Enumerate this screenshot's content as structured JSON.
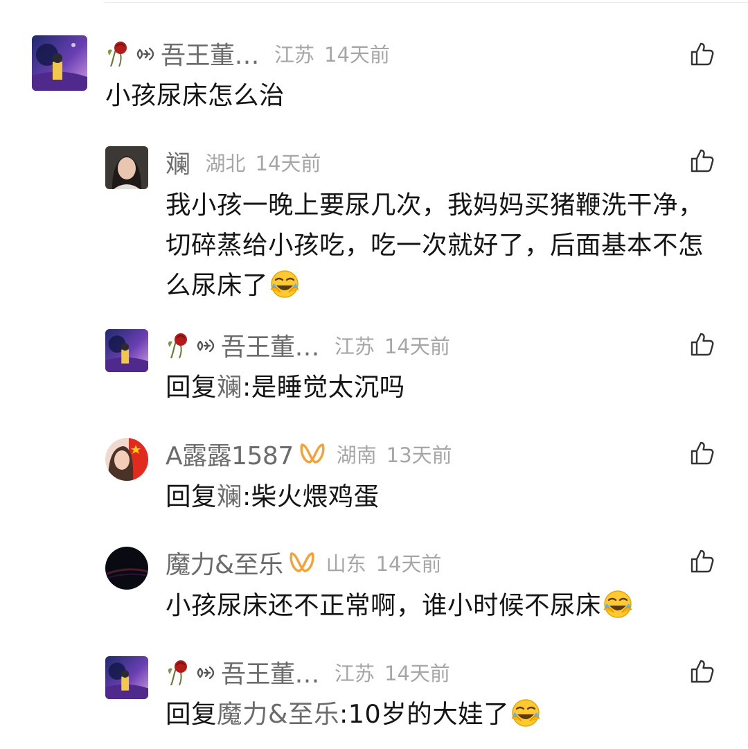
{
  "comments": [
    {
      "username": "吾王董…",
      "location": "江苏",
      "time": "14天前",
      "text": "小孩尿床怎么治"
    },
    {
      "username": "斓",
      "location": "湖北",
      "time": "14天前",
      "text": "我小孩一晚上要尿几次，我妈妈买猪鞭洗干净，切碎蒸给小孩吃，吃一次就好了，后面基本不怎么尿床了"
    },
    {
      "username": "吾王董…",
      "location": "江苏",
      "time": "14天前",
      "reply_prefix": "回复",
      "reply_target": "斓",
      "text": ":是睡觉太沉吗"
    },
    {
      "username": "A露露1587",
      "location": "湖南",
      "time": "13天前",
      "reply_prefix": "回复",
      "reply_target": "斓",
      "text": ":柴火煨鸡蛋"
    },
    {
      "username": "魔力&至乐",
      "location": "山东",
      "time": "14天前",
      "text": "小孩尿床还不正常啊，谁小时候不尿床"
    },
    {
      "username": "吾王董…",
      "location": "江苏",
      "time": "14天前",
      "reply_prefix": "回复",
      "reply_target": "魔力&至乐",
      "text": ":10岁的大娃了"
    }
  ],
  "icons": {
    "like": "thumbs-up-icon",
    "emoji": "face-with-tears-of-joy-emoji",
    "vip_badge": "vip-badge-icon",
    "name_decoration": "rose-decoration-icon"
  },
  "colors": {
    "username": "#6b6b6b",
    "meta": "#a6a6a6",
    "text": "#151515",
    "badge": "#f4a236"
  }
}
